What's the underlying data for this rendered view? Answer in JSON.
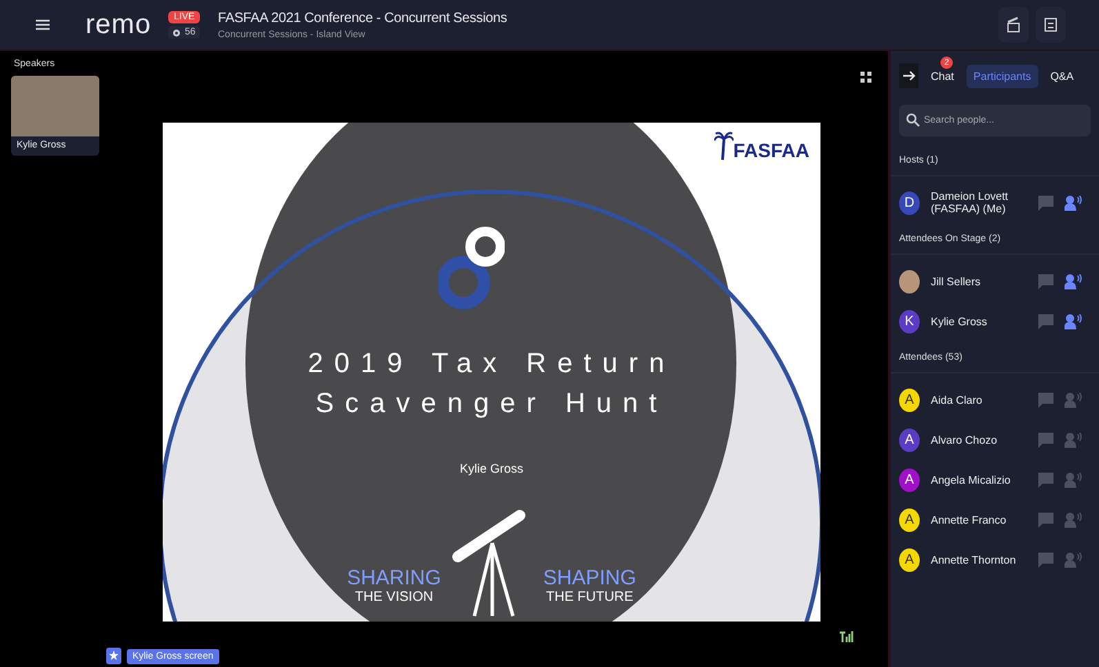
{
  "header": {
    "logo": "remo",
    "live_badge": "LIVE",
    "viewer_count": "56",
    "title": "FASFAA 2021 Conference - Concurrent Sessions",
    "subtitle": "Concurrent Sessions - Island View"
  },
  "speakers": {
    "heading": "Speakers",
    "tiles": [
      {
        "name": "Kylie Gross"
      }
    ]
  },
  "slide": {
    "logo": "FASFAA",
    "title_lines": [
      "2019 Tax Return",
      "Scavenger Hunt"
    ],
    "presenter": "Kylie Gross",
    "left_tag": [
      "SHARING",
      "THE VISION"
    ],
    "right_tag": [
      "SHAPING",
      "THE FUTURE"
    ]
  },
  "screen_label": "Kylie Gross screen",
  "panel": {
    "tabs": [
      {
        "label": "Chat",
        "selected": false,
        "badge": "2"
      },
      {
        "label": "Participants",
        "selected": true
      },
      {
        "label": "Q&A",
        "selected": false
      }
    ],
    "search": {
      "placeholder": "Search people..."
    },
    "sections": [
      {
        "heading": "Hosts (1)",
        "people": [
          {
            "kind": "letter",
            "initial": "D",
            "color": "#3848b8",
            "name": "Dameion Lovett (FASFAA) (Me)",
            "speaking": true
          }
        ]
      },
      {
        "heading": "Attendees On Stage (2)",
        "people": [
          {
            "kind": "photo",
            "name": "Jill Sellers",
            "speaking": true
          },
          {
            "kind": "letter",
            "initial": "K",
            "color": "#5b3cc4",
            "name": "Kylie Gross",
            "speaking": true
          }
        ]
      },
      {
        "heading": "Attendees (53)",
        "people": [
          {
            "kind": "letter",
            "initial": "A",
            "color": "#f5d800",
            "name": "Aida Claro",
            "speaking": false
          },
          {
            "kind": "letter",
            "initial": "A",
            "color": "#5b3cc4",
            "name": "Alvaro Chozo",
            "speaking": false
          },
          {
            "kind": "letter",
            "initial": "A",
            "color": "#a010c8",
            "name": "Angela Micalizio",
            "speaking": false
          },
          {
            "kind": "letter",
            "initial": "A",
            "color": "#f5d800",
            "name": "Annette Franco",
            "speaking": false
          },
          {
            "kind": "letter",
            "initial": "A",
            "color": "#f5d800",
            "name": "Annette Thornton",
            "speaking": false
          }
        ]
      }
    ]
  }
}
